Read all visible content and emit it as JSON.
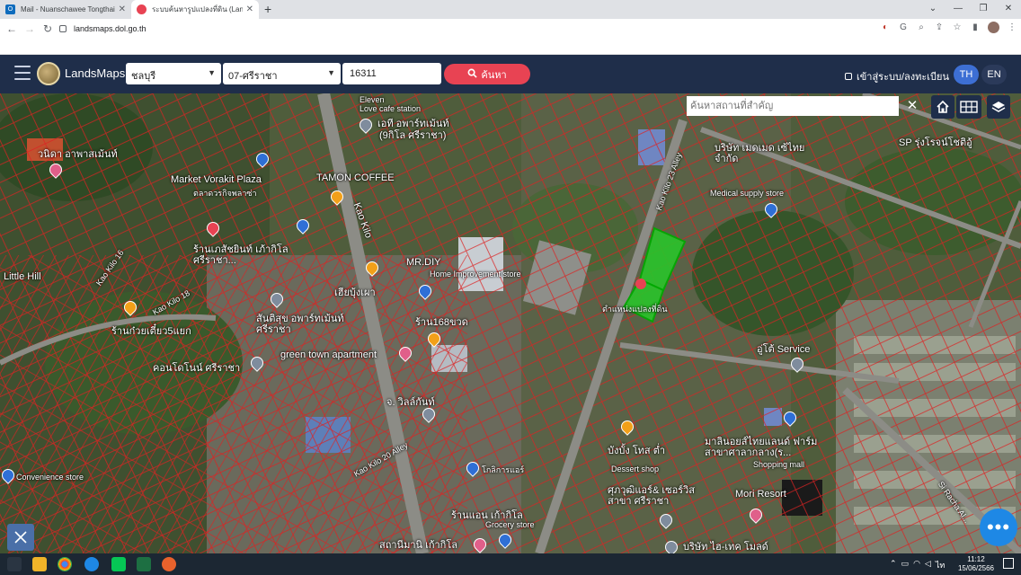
{
  "browser": {
    "tabs": [
      {
        "title": "Mail - Nuanschawee Tongthai - C",
        "icon": "outlook-icon"
      },
      {
        "title": "ระบบค้นหารูปแปลงที่ดิน (LandsMaps)",
        "icon": "map-pin-icon"
      }
    ],
    "url": "landsmaps.dol.go.th"
  },
  "app": {
    "brand": "LandsMaps",
    "province": "ชลบุรี",
    "district": "07-ศรีราชา",
    "parcel_number": "16311",
    "search_label": "ค้นหา",
    "login_label": "เข้าสู่ระบบ/ลงทะเบียน",
    "lang_th": "TH",
    "lang_en": "EN",
    "place_search_placeholder": "ค้นหาสถานที่สำคัญ",
    "accent": "#e84353",
    "header_bg": "#1f2e4a"
  },
  "map": {
    "labels": [
      {
        "text": "Love cafe station"
      },
      {
        "text": "เอที อพาร์ทเม้นท์"
      },
      {
        "text": "(9กิโล ศรีราชา)"
      },
      {
        "text": "วนิดา อาพาสเม้นท์"
      },
      {
        "text": "Market Vorakit Plaza"
      },
      {
        "text": "ตลาดวรกิจพลาซ่า"
      },
      {
        "text": "TAMON COFFEE"
      },
      {
        "text": "Kao Kilo"
      },
      {
        "text": "MR.DIY"
      },
      {
        "text": "Home Improvement store"
      },
      {
        "text": "ร้านเภสัชยินท์ เภ้ากิโล ศรีราชา..."
      },
      {
        "text": "Little Hill"
      },
      {
        "text": "Kao Kilo 16"
      },
      {
        "text": "Kao Kilo 18"
      },
      {
        "text": "เฮียบุ้งเผา"
      },
      {
        "text": "ร้าน168ขวด"
      },
      {
        "text": "ร้านก๋วยเตี๋ยว5แยก"
      },
      {
        "text": "สันติสุข อพาร์ทเม้นท์ ศรีราชา"
      },
      {
        "text": "green town apartment"
      },
      {
        "text": "คอนโดโนน์ ศรีราชา"
      },
      {
        "text": "จ. วิลล์กันท์"
      },
      {
        "text": "Kao Kilo 23 Alley"
      },
      {
        "text": "บริษัท เมดเมด เซ้ไทย จำกัด"
      },
      {
        "text": "Medical supply store"
      },
      {
        "text": "SP รุ่งโรจน์โชติอู้"
      },
      {
        "text": "ตำแหน่งแปลงที่ดิน"
      },
      {
        "text": "อู่โต้ Service"
      },
      {
        "text": "บังบั้ง โทส ต่ำ"
      },
      {
        "text": "Dessert shop"
      },
      {
        "text": "มาลินอยส์ไทยแลนด์ ฟาร์ม สาขาศาลากลาง(ร..."
      },
      {
        "text": "Shopping mall"
      },
      {
        "text": "Convenience store"
      },
      {
        "text": "Kao Kilo 20 Alley"
      },
      {
        "text": "โกลิการแอร์"
      },
      {
        "text": "ศุภวุฒิแอร์& เซอร์วิส สาขา ศรีราชา"
      },
      {
        "text": "Mori Resort"
      },
      {
        "text": "ร้านแอน เก้ากิโล"
      },
      {
        "text": "Grocery store"
      },
      {
        "text": "สถานีมานิ เก้ากิโล"
      },
      {
        "text": "บริษัท ไฮ-เทค โมลด์"
      },
      {
        "text": "Si Racha Al..."
      },
      {
        "text": "Eleven"
      }
    ]
  },
  "taskbar": {
    "time": "11:12",
    "date": "15/06/2566"
  }
}
